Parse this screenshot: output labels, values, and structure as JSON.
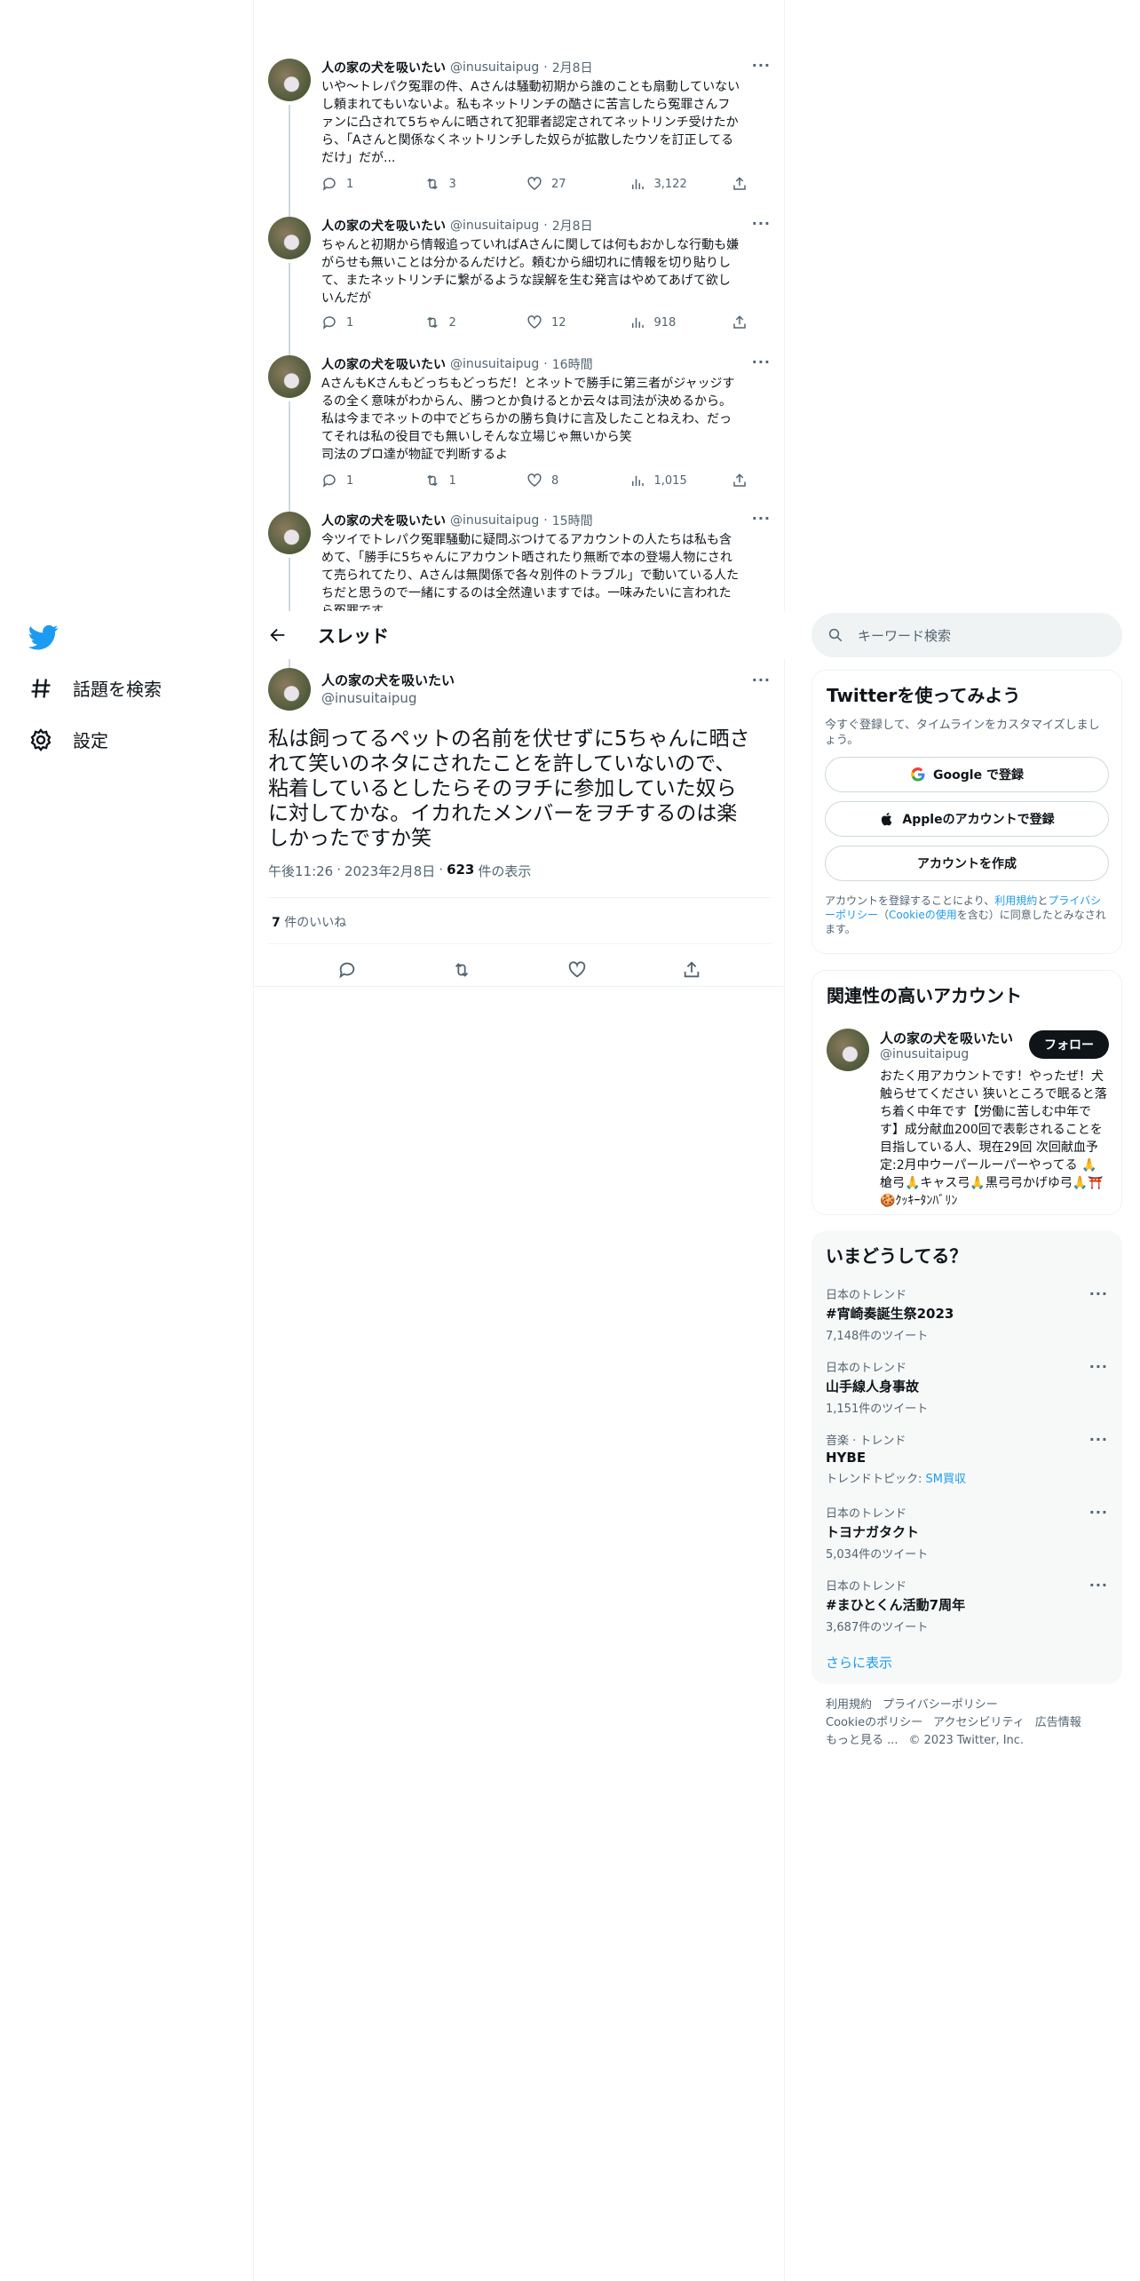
{
  "nav": {
    "logo": "twitter-bird-icon",
    "explore_label": "話題を検索",
    "settings_label": "設定"
  },
  "replies": [
    {
      "name": "人の家の犬を吸いたい",
      "handle": "@inusuitaipug",
      "dot": "·",
      "time": "2月8日",
      "text": "いや〜トレパク冤罪の件、Aさんは騒動初期から誰のことも扇動していない\nし頼まれてもいないよ。私もネットリンチの酷さに苦言したら冤罪さんフ\nァンに凸されて5ちゃんに晒されて犯罪者認定されてネットリンチ受けたか\nら、「Aさんと関係なくネットリンチした奴らが拡散したウソを訂正してる\nだけ」だが...",
      "replies": "1",
      "retweets": "3",
      "likes": "27",
      "views": "3,122"
    },
    {
      "name": "人の家の犬を吸いたい",
      "handle": "@inusuitaipug",
      "dot": "·",
      "time": "2月8日",
      "text": "ちゃんと初期から情報追っていればAさんに関しては何もおかしな行動も嫌\nがらせも無いことは分かるんだけど。頼むから細切れに情報を切り貼りし\nて、またネットリンチに繋がるような誤解を生む発言はやめてあげて欲し\nいんだが",
      "replies": "1",
      "retweets": "2",
      "likes": "12",
      "views": "918"
    },
    {
      "name": "人の家の犬を吸いたい",
      "handle": "@inusuitaipug",
      "dot": "·",
      "time": "16時間",
      "text": "AさんもKさんもどっちもどっちだ！とネットで勝手に第三者がジャッジす\nるの全く意味がわからん、勝つとか負けるとか云々は司法が決めるから。\n私は今までネットの中でどちらかの勝ち負けに言及したことねえわ、だっ\nてそれは私の役目でも無いしそんな立場じゃ無いから笑\n司法のプロ達が物証で判断するよ",
      "replies": "1",
      "retweets": "1",
      "likes": "8",
      "views": "1,015"
    },
    {
      "name": "人の家の犬を吸いたい",
      "handle": "@inusuitaipug",
      "dot": "·",
      "time": "15時間",
      "text": "今ツイでトレパク冤罪騒動に疑問ぶつけてるアカウントの人たちは私も含\nめて、「勝手に5ちゃんにアカウント晒されたり無断で本の登場人物にされ\nて売られてたり、Aさんは無関係で各々別件のトラブル」で動いている人た\nちだと思うので一緒にするのは全然違いますでは。一味みたいに言われた\nら冤罪です。"
    }
  ],
  "header": {
    "title": "スレッド"
  },
  "focus": {
    "name": "人の家の犬を吸いたい",
    "handle": "@inusuitaipug",
    "text": "私は飼ってるペットの名前を伏せずに5ちゃんに晒さ\nれて笑いのネタにされたことを許していないので、\n粘着しているとしたらそのヲチに参加していた奴ら\nに対してかな。イカれたメンバーをヲチするのは楽\nしかったですか笑",
    "time": "午後11:26",
    "dot": "·",
    "date": "2023年2月8日",
    "views_count": "623",
    "views_label": "件の表示",
    "likes_count": "7",
    "likes_label": "件のいいね"
  },
  "search": {
    "placeholder": "キーワード検索"
  },
  "signup": {
    "title": "Twitterを使ってみよう",
    "subtitle": "今すぐ登録して、タイムラインをカスタマイズしましょう。",
    "google_label": "Google で登録",
    "apple_label": "Appleのアカウントで登録",
    "create_label": "アカウントを作成",
    "legal_prefix": "アカウントを登録することにより、",
    "terms_link": "利用規約",
    "and": "と",
    "privacy_link": "プライバシーポリシー",
    "cookie_open": "（",
    "cookie_link": "Cookieの使用",
    "legal_suffix": "を含む）に同意したとみなされます。"
  },
  "related": {
    "title": "関連性の高いアカウント",
    "name": "人の家の犬を吸いたい",
    "handle": "@inusuitaipug",
    "follow_label": "フォロー",
    "bio": "おたく用アカウントです！やったぜ！犬触らせてください 狭いところで眠ると落ち着く中年です【労働に苦しむ中年です】成分献血200回で表彰されることを目指している人、現在29回 次回献血予定:2月中ウーパールーパーやってる 🙏槍弓🙏キャス弓🙏黒弓弓かげゆ弓🙏⛩️🍪ｸｯｷｰﾀﾝﾊﾞﾘﾝ"
  },
  "trends": {
    "title": "いまどうしてる？",
    "items": [
      {
        "category": "日本のトレンド",
        "name": "#宵崎奏誕生祭2023",
        "count": "7,148件のツイート"
      },
      {
        "category": "日本のトレンド",
        "name": "山手線人身事故",
        "count": "1,151件のツイート"
      },
      {
        "category": "音楽 · トレンド",
        "name": "HYBE",
        "count": "トレンドトピック: ",
        "link": "SM買収"
      },
      {
        "category": "日本のトレンド",
        "name": "トヨナガタクト",
        "count": "5,034件のツイート"
      },
      {
        "category": "日本のトレンド",
        "name": "#まひとくん活動7周年",
        "count": "3,687件のツイート"
      }
    ],
    "show_more": "さらに表示"
  },
  "footer": {
    "terms": "利用規約",
    "privacy": "プライバシーポリシー",
    "cookie": "Cookieのポリシー",
    "accessibility": "アクセシビリティ",
    "ads": "広告情報",
    "more": "もっと見る ...",
    "copyright": "© 2023 Twitter, Inc."
  },
  "colors": {
    "accent": "#1d9bf0",
    "text": "#0f1419",
    "muted": "#536471"
  }
}
